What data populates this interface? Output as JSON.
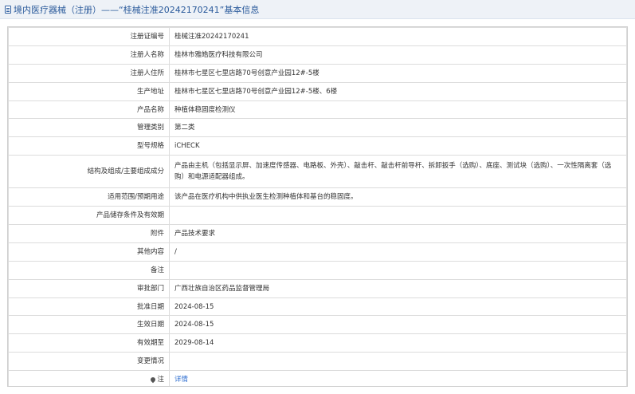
{
  "header": {
    "title": "境内医疗器械（注册）——“桂械注准20242170241”基本信息"
  },
  "rows": [
    {
      "label": "注册证编号",
      "value": "桂械注准20242170241"
    },
    {
      "label": "注册人名称",
      "value": "桂林市雅皓医疗科技有限公司"
    },
    {
      "label": "注册人住所",
      "value": "桂林市七星区七里店路70号创意产业园12#-5楼"
    },
    {
      "label": "生产地址",
      "value": "桂林市七星区七里店路70号创意产业园12#-5楼、6楼"
    },
    {
      "label": "产品名称",
      "value": "种植体稳固度检测仪"
    },
    {
      "label": "管理类别",
      "value": "第二类"
    },
    {
      "label": "型号规格",
      "value": "iCHECK"
    },
    {
      "label": "结构及组成/主要组成成分",
      "value": "产品由主机（包括显示屏、加速度传感器、电路板、外壳）、敲击杆、敲击杆前导杆、拆卸扳手（选购）、底座、测试块（选购）、一次性隔离套（选购）和电源适配器组成。"
    },
    {
      "label": "适用范围/预期用途",
      "value": "该产品在医疗机构中供执业医生检测种植体和基台的稳固度。"
    },
    {
      "label": "产品储存条件及有效期",
      "value": ""
    },
    {
      "label": "附件",
      "value": "产品技术要求"
    },
    {
      "label": "其他内容",
      "value": "/"
    },
    {
      "label": "备注",
      "value": ""
    },
    {
      "label": "审批部门",
      "value": "广西壮族自治区药品监督管理局"
    },
    {
      "label": "批准日期",
      "value": "2024-08-15"
    },
    {
      "label": "生效日期",
      "value": "2024-08-15"
    },
    {
      "label": "有效期至",
      "value": "2029-08-14"
    },
    {
      "label": "变更情况",
      "value": ""
    },
    {
      "label": "注",
      "value": "详情"
    }
  ]
}
